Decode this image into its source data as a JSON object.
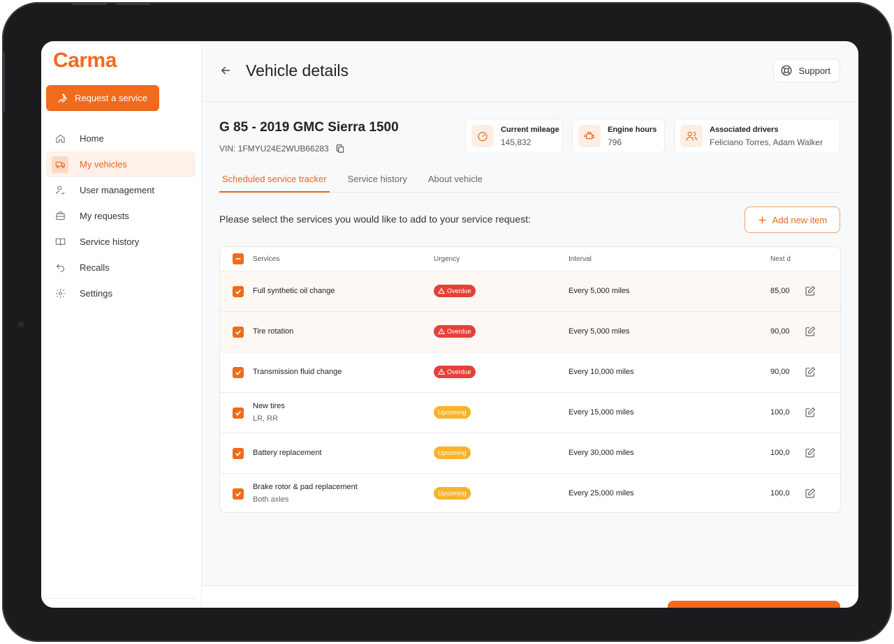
{
  "brand": {
    "name": "Carma",
    "accent": "#f26a1b"
  },
  "sidebar": {
    "request_button": "Request a service",
    "items": [
      {
        "label": "Home",
        "icon": "home-icon",
        "active": false
      },
      {
        "label": "My vehicles",
        "icon": "truck-icon",
        "active": true
      },
      {
        "label": "User management",
        "icon": "user-check-icon",
        "active": false
      },
      {
        "label": "My requests",
        "icon": "briefcase-icon",
        "active": false
      },
      {
        "label": "Service history",
        "icon": "book-icon",
        "active": false
      },
      {
        "label": "Recalls",
        "icon": "undo-icon",
        "active": false
      },
      {
        "label": "Settings",
        "icon": "gear-icon",
        "active": false
      }
    ]
  },
  "header": {
    "title": "Vehicle details",
    "support_label": "Support"
  },
  "vehicle": {
    "title": "G 85 - 2019 GMC Sierra 1500",
    "vin": "VIN: 1FMYU24E2WUB66283",
    "stats": [
      {
        "label": "Current mileage",
        "value": "145,832",
        "icon": "speedometer-icon"
      },
      {
        "label": "Engine hours",
        "value": "796",
        "icon": "engine-icon"
      },
      {
        "label": "Associated drivers",
        "value": "Feliciano Torres, Adam Walker",
        "icon": "users-icon"
      }
    ]
  },
  "tabs": [
    "Scheduled service tracker",
    "Service history",
    "About vehicle"
  ],
  "prompt": "Please select the services you would like to add to your service request:",
  "add_item_label": "Add new item",
  "table": {
    "headers": {
      "services": "Services",
      "urgency": "Urgency",
      "interval": "Interval",
      "next": "Next d"
    },
    "rows": [
      {
        "service": "Full synthetic oil change",
        "sub": "",
        "urgency": "Overdue",
        "interval": "Every 5,000 miles",
        "next": "85,00"
      },
      {
        "service": "Tire rotation",
        "sub": "",
        "urgency": "Overdue",
        "interval": "Every 5,000 miles",
        "next": "90,00"
      },
      {
        "service": "Transmission fluid change",
        "sub": "",
        "urgency": "Overdue",
        "interval": "Every 10,000 miles",
        "next": "90,00"
      },
      {
        "service": "New tires",
        "sub": "LR, RR",
        "urgency": "Upcoming",
        "interval": "Every 15,000 miles",
        "next": "100,0"
      },
      {
        "service": "Battery replacement",
        "sub": "",
        "urgency": "Upcoming",
        "interval": "Every 30,000 miles",
        "next": "100,0"
      },
      {
        "service": "Brake rotor & pad replacement",
        "sub": "Both axles",
        "urgency": "Upcoming",
        "interval": "Every 25,000 miles",
        "next": "100,0"
      }
    ]
  }
}
